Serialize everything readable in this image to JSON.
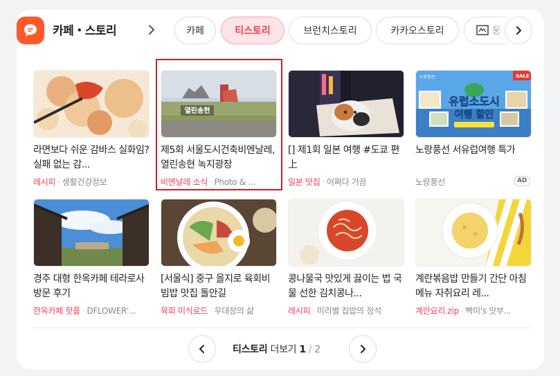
{
  "header": {
    "title": "카페・스토리",
    "icon": "chat-bubble-icon",
    "accent": "#ff5a2a"
  },
  "tabs": [
    {
      "label": "카페",
      "active": false
    },
    {
      "label": "티스토리",
      "active": true
    },
    {
      "label": "브런치스토리",
      "active": false
    },
    {
      "label": "카카오스토리",
      "active": false
    },
    {
      "label": "웅",
      "active": false
    }
  ],
  "items": [
    {
      "title": "라면보다 쉬운 감바스 실화임? 실패 없는 감...",
      "category": "레시피",
      "source": "생활건강정보",
      "image": "food-gambas"
    },
    {
      "title": "제5회 서울도시건축비엔날레, 열린송현 녹지광장",
      "category": "비엔날레 소식",
      "source": "Photo & ...",
      "image": "songhyeon-park",
      "highlighted": true
    },
    {
      "title": "[] 제1회 일본 여행 #도쿄 편 上",
      "category": "일본 맛집",
      "source": "어쩌다 가끔",
      "image": "tokyo-cat-billboard"
    },
    {
      "title": "노랑풍선 서유럽여행 특가",
      "category": "",
      "source": "노랑풍선",
      "image": "europe-travel-ad",
      "ad": "AD"
    },
    {
      "title": "경주 대형 한옥카페 테라로사 방문 후기",
      "category": "한옥카페 핫플",
      "source": "DFLOWER'...",
      "image": "hanok-cafe"
    },
    {
      "title": "[서울식] 중구 을지로 육회비빔밥 맛집 돌안길",
      "category": "육회 미식로드",
      "source": "우대장의 삶",
      "image": "bibimbap"
    },
    {
      "title": "콩나물국 맛있게 끓이는 법 국물 선한 김치콩나...",
      "category": "레시피",
      "source": "미리별 집밥의 정석",
      "image": "bean-sprout-soup"
    },
    {
      "title": "계란볶음밥 만들기 간단 아침메뉴 자취요리 레...",
      "category": "계란요리.zip",
      "source": "빡미's 맛부...",
      "image": "egg-fried-rice"
    }
  ],
  "europe_ad_text": {
    "line1": "유럽소도시",
    "line2": "여행 할인",
    "badge": "SALE",
    "brand": "노랑풍선"
  },
  "songhyeon_sign": "열린송현",
  "pager": {
    "label_bold": "티스토리",
    "label_more": "더보기",
    "current": "1",
    "total": "2"
  },
  "colors": {
    "highlight_border": "#d01f28",
    "active_tab_bg": "#fde5e7",
    "active_tab_text": "#ee3f55",
    "category_text": "#ee3f55"
  }
}
